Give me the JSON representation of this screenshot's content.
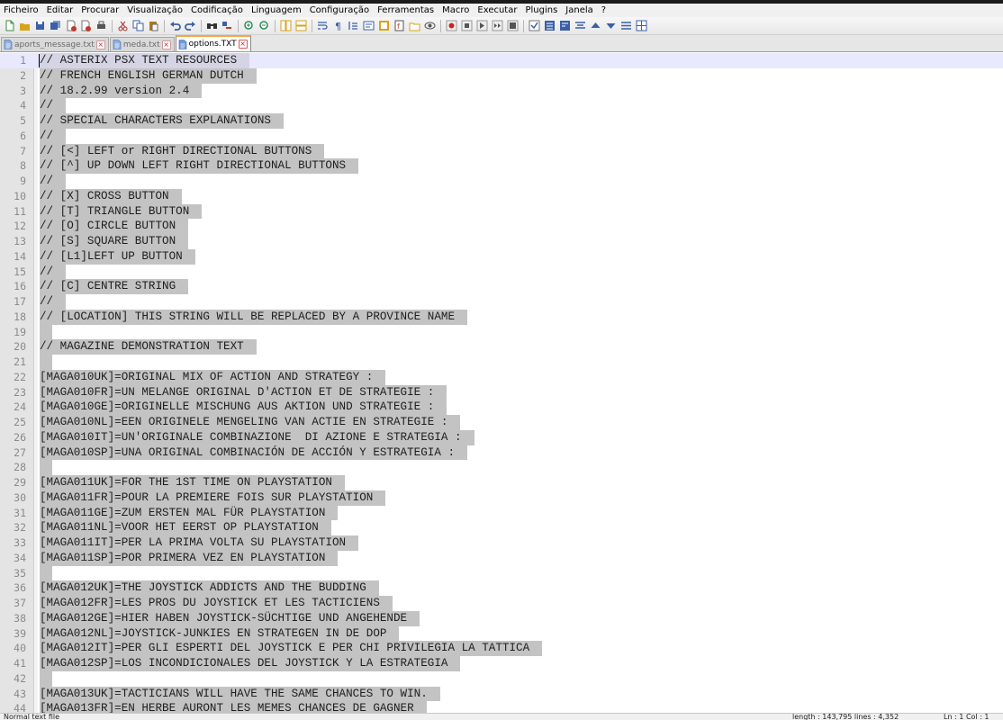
{
  "menu": [
    "Ficheiro",
    "Editar",
    "Procurar",
    "Visualização",
    "Codificação",
    "Linguagem",
    "Configuração",
    "Ferramentas",
    "Macro",
    "Executar",
    "Plugins",
    "Janela",
    "?"
  ],
  "toolbar": {
    "buttons": [
      {
        "icon": "new-file-icon",
        "color": "#3c8c3c"
      },
      {
        "icon": "open-file-icon",
        "color": "#d9a21b"
      },
      {
        "icon": "save-icon",
        "color": "#3b5fa8"
      },
      {
        "icon": "save-all-icon",
        "color": "#3b5fa8"
      },
      {
        "icon": "close-file-icon",
        "color": "#c0392b"
      },
      {
        "icon": "close-all-icon",
        "color": "#c0392b"
      },
      {
        "icon": "print-icon",
        "color": "#555555"
      },
      "sep",
      {
        "icon": "cut-icon",
        "color": "#b03030"
      },
      {
        "icon": "copy-icon",
        "color": "#3b5fa8"
      },
      {
        "icon": "paste-icon",
        "color": "#b07a20"
      },
      "sep",
      {
        "icon": "undo-icon",
        "color": "#3b5fa8"
      },
      {
        "icon": "redo-icon",
        "color": "#3b5fa8"
      },
      "sep",
      {
        "icon": "find-icon",
        "color": "#333333"
      },
      {
        "icon": "replace-icon",
        "color": "#3b5fa8"
      },
      "sep",
      {
        "icon": "zoom-in-icon",
        "color": "#2e8b57"
      },
      {
        "icon": "zoom-out-icon",
        "color": "#2e8b57"
      },
      "sep",
      {
        "icon": "sync-vertical-icon",
        "color": "#d9a21b"
      },
      {
        "icon": "sync-horizontal-icon",
        "color": "#d9a21b"
      },
      "sep",
      {
        "icon": "word-wrap-icon",
        "color": "#3b5fa8"
      },
      {
        "icon": "show-all-chars-icon",
        "color": "#3b5fa8"
      },
      {
        "icon": "indent-guide-icon",
        "color": "#3b5fa8"
      },
      {
        "icon": "language-icon",
        "color": "#3b5fa8"
      },
      {
        "icon": "document-map-icon",
        "color": "#d9a21b"
      },
      {
        "icon": "function-list-icon",
        "color": "#c0392b"
      },
      {
        "icon": "folder-workspace-icon",
        "color": "#d9a21b"
      },
      {
        "icon": "monitoring-icon",
        "color": "#555555"
      },
      "sep",
      {
        "icon": "record-macro-icon",
        "color": "#d42020"
      },
      {
        "icon": "stop-record-icon",
        "color": "#555555"
      },
      {
        "icon": "play-macro-icon",
        "color": "#555555"
      },
      {
        "icon": "run-macro-multiple-icon",
        "color": "#555555"
      },
      {
        "icon": "save-macro-icon",
        "color": "#555555"
      },
      "sep",
      {
        "icon": "spell-check-icon",
        "color": "#3b5fa8"
      },
      {
        "icon": "compare-icon",
        "color": "#3b5fa8"
      },
      {
        "icon": "compare-next-icon",
        "color": "#3b5fa8"
      },
      {
        "icon": "align-icon",
        "color": "#3b5fa8"
      },
      {
        "icon": "arrow-up-icon",
        "color": "#3b5fa8"
      },
      {
        "icon": "arrow-down-icon",
        "color": "#3b5fa8"
      },
      {
        "icon": "sort-icon",
        "color": "#3b5fa8"
      },
      {
        "icon": "columns-icon",
        "color": "#3b5fa8"
      }
    ]
  },
  "tabs": [
    {
      "label": "aports_message.txt",
      "active": false
    },
    {
      "label": "meda.txt",
      "active": false
    },
    {
      "label": "options.TXT",
      "active": true
    }
  ],
  "editor": {
    "current_line": 1,
    "lines": [
      {
        "n": "1",
        "text": "// ASTERIX PSX TEXT RESOURCES"
      },
      {
        "n": "2",
        "text": "// FRENCH ENGLISH GERMAN DUTCH"
      },
      {
        "n": "3",
        "text": "// 18.2.99 version 2.4"
      },
      {
        "n": "4",
        "text": "//"
      },
      {
        "n": "5",
        "text": "// SPECIAL CHARACTERS EXPLANATIONS"
      },
      {
        "n": "6",
        "text": "//"
      },
      {
        "n": "7",
        "text": "// [<] LEFT or RIGHT DIRECTIONAL BUTTONS"
      },
      {
        "n": "8",
        "text": "// [^] UP DOWN LEFT RIGHT DIRECTIONAL BUTTONS"
      },
      {
        "n": "9",
        "text": "//"
      },
      {
        "n": "10",
        "text": "// [X] CROSS BUTTON"
      },
      {
        "n": "11",
        "text": "// [T] TRIANGLE BUTTON"
      },
      {
        "n": "12",
        "text": "// [O] CIRCLE BUTTON"
      },
      {
        "n": "13",
        "text": "// [S] SQUARE BUTTON"
      },
      {
        "n": "14",
        "text": "// [L1]LEFT UP BUTTON"
      },
      {
        "n": "15",
        "text": "//"
      },
      {
        "n": "16",
        "text": "// [C] CENTRE STRING"
      },
      {
        "n": "17",
        "text": "//"
      },
      {
        "n": "18",
        "text": "// [LOCATION] THIS STRING WILL BE REPLACED BY A PROVINCE NAME"
      },
      {
        "n": "19",
        "text": ""
      },
      {
        "n": "20",
        "text": "// MAGAZINE DEMONSTRATION TEXT"
      },
      {
        "n": "21",
        "text": ""
      },
      {
        "n": "22",
        "text": "[MAGA010UK]=ORIGINAL MIX OF ACTION AND STRATEGY :"
      },
      {
        "n": "23",
        "text": "[MAGA010FR]=UN MELANGE ORIGINAL D'ACTION ET DE STRATEGIE :"
      },
      {
        "n": "24",
        "text": "[MAGA010GE]=ORIGINELLE MISCHUNG AUS AKTION UND STRATEGIE :"
      },
      {
        "n": "25",
        "text": "[MAGA010NL]=EEN ORIGINELE MENGELING VAN ACTIE EN STRATEGIE :"
      },
      {
        "n": "26",
        "text": "[MAGA010IT]=UN'ORIGINALE COMBINAZIONE  DI AZIONE E STRATEGIA :"
      },
      {
        "n": "27",
        "text": "[MAGA010SP]=UNA ORIGINAL COMBINACIÓN DE ACCIÓN Y ESTRATEGIA :"
      },
      {
        "n": "28",
        "text": ""
      },
      {
        "n": "29",
        "text": "[MAGA011UK]=FOR THE 1ST TIME ON PLAYSTATION"
      },
      {
        "n": "30",
        "text": "[MAGA011FR]=POUR LA PREMIERE FOIS SUR PLAYSTATION"
      },
      {
        "n": "31",
        "text": "[MAGA011GE]=ZUM ERSTEN MAL FÜR PLAYSTATION"
      },
      {
        "n": "32",
        "text": "[MAGA011NL]=VOOR HET EERST OP PLAYSTATION"
      },
      {
        "n": "33",
        "text": "[MAGA011IT]=PER LA PRIMA VOLTA SU PLAYSTATION"
      },
      {
        "n": "34",
        "text": "[MAGA011SP]=POR PRIMERA VEZ EN PLAYSTATION"
      },
      {
        "n": "35",
        "text": ""
      },
      {
        "n": "36",
        "text": "[MAGA012UK]=THE JOYSTICK ADDICTS AND THE BUDDING"
      },
      {
        "n": "37",
        "text": "[MAGA012FR]=LES PROS DU JOYSTICK ET LES TACTICIENS"
      },
      {
        "n": "38",
        "text": "[MAGA012GE]=HIER HABEN JOYSTICK-SÜCHTIGE UND ANGEHENDE"
      },
      {
        "n": "39",
        "text": "[MAGA012NL]=JOYSTICK-JUNKIES EN STRATEGEN IN DE DOP"
      },
      {
        "n": "40",
        "text": "[MAGA012IT]=PER GLI ESPERTI DEL JOYSTICK E PER CHI PRIVILEGIA LA TATTICA"
      },
      {
        "n": "41",
        "text": "[MAGA012SP]=LOS INCONDICIONALES DEL JOYSTICK Y LA ESTRATEGIA"
      },
      {
        "n": "42",
        "text": ""
      },
      {
        "n": "43",
        "text": "[MAGA013UK]=TACTICIANS WILL HAVE THE SAME CHANCES TO WIN."
      },
      {
        "n": "44",
        "text": "[MAGA013FR]=EN HERBE AURONT LES MEMES CHANCES DE GAGNER"
      }
    ]
  },
  "status": {
    "file_type": "Normal text file",
    "length": "length : 143,795    lines : 4,352",
    "position": "Ln : 1    Col : 1"
  }
}
